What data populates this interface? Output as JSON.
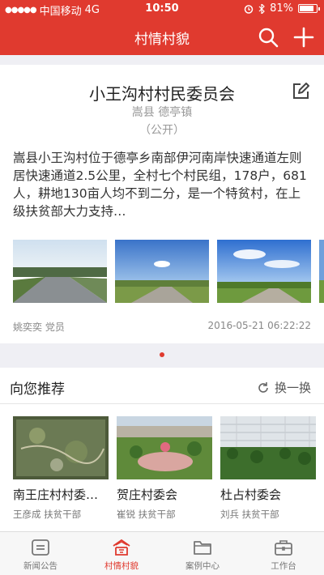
{
  "status": {
    "carrier": "中国移动",
    "network": "4G",
    "time": "10:50",
    "battery": "81%"
  },
  "nav": {
    "title": "村情村貌"
  },
  "village": {
    "title": "小王沟村村民委员会",
    "location": "嵩县 德亭镇",
    "visibility": "（公开）",
    "description": "嵩县小王沟村位于德亭乡南部伊河南岸快速通道左则居快速通道2.5公里，全村七个村民组，178户，681人，耕地130亩人均不到二分，是一个特贫村，在上级扶贫部大力支持…",
    "author": "姚奕奕 党员",
    "date": "2016-05-21 06:22:22"
  },
  "recommend": {
    "header": "向您推荐",
    "refresh_label": "换一换",
    "items": [
      {
        "name": "南王庄村村委…",
        "person": "王彦成 扶贫干部"
      },
      {
        "name": "贺庄村委会",
        "person": "崔锐 扶贫干部"
      },
      {
        "name": "杜占村委会",
        "person": "刘兵 扶贫干部"
      }
    ]
  },
  "tabs": [
    {
      "label": "新闻公告",
      "icon": "news-icon"
    },
    {
      "label": "村情村貌",
      "icon": "village-icon",
      "active": true
    },
    {
      "label": "案例中心",
      "icon": "folder-icon"
    },
    {
      "label": "工作台",
      "icon": "briefcase-icon"
    }
  ],
  "colors": {
    "brand": "#e03a2f",
    "accent_text": "#e03a2f"
  }
}
